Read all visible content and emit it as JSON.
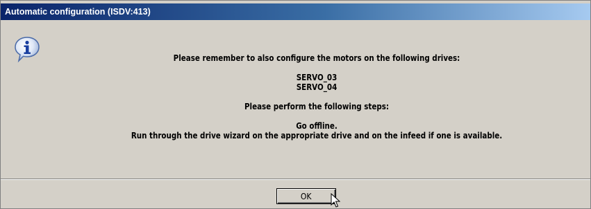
{
  "window": {
    "title": "Automatic configuration (ISDV:413)"
  },
  "icon": "info-icon",
  "message": {
    "line1": "Please remember to also configure the motors on the following drives:",
    "drives": [
      "SERVO_03",
      "SERVO_04"
    ],
    "steps_heading": "Please perform the following steps:",
    "steps": [
      "Go offline.",
      "Run through the drive wizard on the appropriate drive and on the infeed if one is available."
    ]
  },
  "buttons": {
    "ok_label": "OK"
  },
  "colors": {
    "dialog_face": "#d4d0c8",
    "titlebar_start": "#0a246a",
    "titlebar_end": "#a6caf0"
  }
}
